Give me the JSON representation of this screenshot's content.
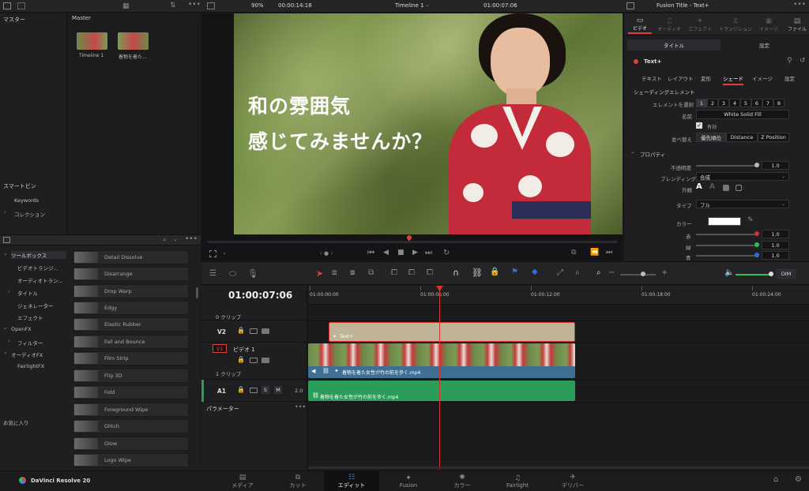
{
  "topbar": {
    "zoom": "90%",
    "source_timecode": "00:00:14:18",
    "timeline_name": "Timeline 1",
    "record_timecode": "01:00:07:06",
    "inspector_title": "Fusion Title - Text+"
  },
  "media_pool": {
    "bins_header": "マスター",
    "master_label": "Master",
    "clips": [
      {
        "label": "Timeline 1"
      },
      {
        "label": "着物を着た..."
      }
    ],
    "smart_bins_header": "スマートビン",
    "smart_bins": [
      "Keywords",
      "コレクション"
    ]
  },
  "effects": {
    "toolbox_header": "ツールボックス",
    "tree": [
      "ビデオトランジ...",
      "オーディオトラン...",
      "タイトル",
      "ジェネレーター",
      "エフェクト",
      "OpenFX",
      "フィルター",
      "オーディオFX",
      "FairlightFX"
    ],
    "favorites": "お気に入り",
    "items": [
      "Detail Dissolve",
      "Disarrange",
      "Drop Warp",
      "Edgy",
      "Elastic Rubber",
      "Fall and Bounce",
      "Film Strip",
      "Flip 3D",
      "Fold",
      "Foreground Wipe",
      "Glitch",
      "Glow",
      "Logo Wipe"
    ]
  },
  "viewer": {
    "title_line1": "和の雰囲気",
    "title_line2": "感じてみませんか？"
  },
  "inspector": {
    "tabs": [
      "ビデオ",
      "オーディオ",
      "エフェクト",
      "トランジション",
      "イメージ",
      "ファイル"
    ],
    "subtabs": [
      "タイトル",
      "設定"
    ],
    "node_name": "Text+",
    "section_tabs": [
      "テキスト",
      "レイアウト",
      "変形",
      "シェード",
      "イメージ",
      "設定"
    ],
    "shading_header": "シェーディングエレメント",
    "select_element_label": "エレメントを選択",
    "element_numbers": [
      "1",
      "2",
      "3",
      "4",
      "5",
      "6",
      "7",
      "8"
    ],
    "name_label": "名前",
    "name_value": "White Solid Fill",
    "enabled_label": "有効",
    "sort_label": "並べ替え",
    "sort_options": [
      "優先順位",
      "Distance",
      "Z Position"
    ],
    "properties_header": "プロパティ",
    "opacity_label": "不透明度",
    "opacity_value": "1.0",
    "blend_label": "ブレンディング",
    "blend_value": "合成",
    "appearance_label": "外観",
    "type_label": "タイプ",
    "type_value": "フル",
    "color_label": "カラー",
    "color_value": "#ffffff",
    "red_label": "赤",
    "red_value": "1.0",
    "green_label": "緑",
    "green_value": "1.0",
    "blue_label": "青",
    "blue_value": "1.0"
  },
  "timeline": {
    "timecode": "01:00:07:06",
    "ruler": [
      "01:00:00:00",
      "01:00:06:00",
      "01:00:12:00",
      "01:00:18:00",
      "01:00:24:00"
    ],
    "tracks": {
      "v2_clip_count": "0 クリップ",
      "v2_label": "V2",
      "v1_badge": "V1",
      "v1_name": "ビデオ 1",
      "v1_clip_count": "1 クリップ",
      "a1_label": "A1",
      "a1_channels": "2.0",
      "solo": "S",
      "mute": "M"
    },
    "clips": {
      "title_clip": "Text+",
      "video_clip": "着物を着た女性が竹の前を歩く.mp4",
      "audio_clip": "着物を着た女性が竹の前を歩く.mp4"
    },
    "params_label": "パラメーター",
    "dim_label": "DIM"
  },
  "bottombar": {
    "app_name": "DaVinci Resolve 20",
    "pages": [
      "メディア",
      "カット",
      "エディット",
      "Fusion",
      "カラー",
      "Fairlight",
      "デリバー"
    ],
    "active_page": "エディット"
  },
  "colors": {
    "accent_red": "#e0403a",
    "playhead": "#d9342b",
    "title_clip": "#bfb497",
    "video_track": "#3f6f93",
    "audio_clip": "#2a9d5a"
  }
}
